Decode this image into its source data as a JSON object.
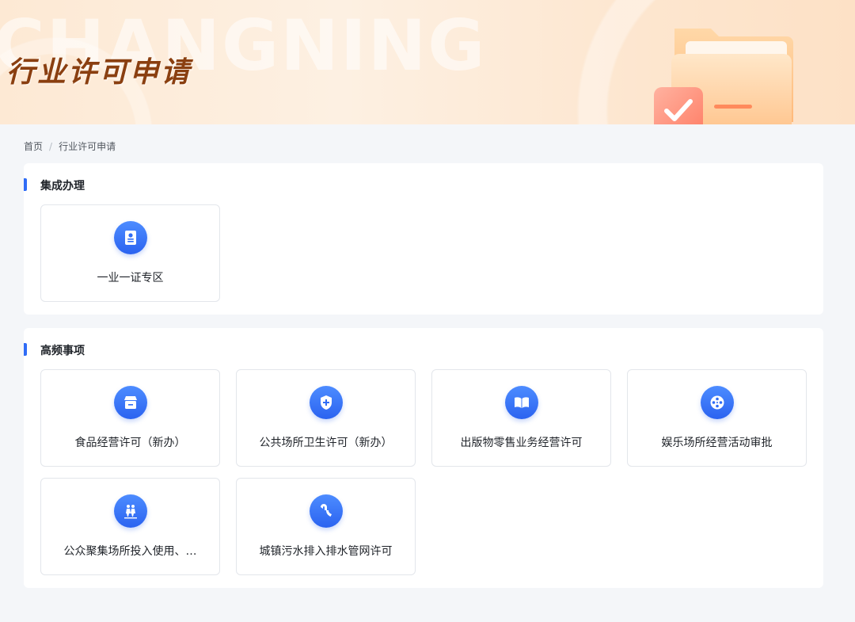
{
  "banner": {
    "title": "行业许可申请",
    "watermark": "CHANGNING"
  },
  "breadcrumb": {
    "home": "首页",
    "separator": "/",
    "current": "行业许可申请"
  },
  "sections": [
    {
      "title": "集成办理",
      "cards": [
        {
          "label": "一业一证专区",
          "icon": "certificate-icon"
        }
      ]
    },
    {
      "title": "高频事项",
      "cards": [
        {
          "label": "食品经营许可（新办）",
          "icon": "storefront-icon"
        },
        {
          "label": "公共场所卫生许可（新办）",
          "icon": "shield-cross-icon"
        },
        {
          "label": "出版物零售业务经营许可",
          "icon": "open-book-icon"
        },
        {
          "label": "娱乐场所经营活动审批",
          "icon": "film-reel-icon"
        },
        {
          "label": "公众聚集场所投入使用、…",
          "icon": "crowd-icon"
        },
        {
          "label": "城镇污水排入排水管网许可",
          "icon": "water-drain-icon"
        }
      ]
    }
  ],
  "colors": {
    "accent": "#2f6cf6",
    "banner_title": "#8a3f10",
    "background": "#f4f6f9"
  }
}
